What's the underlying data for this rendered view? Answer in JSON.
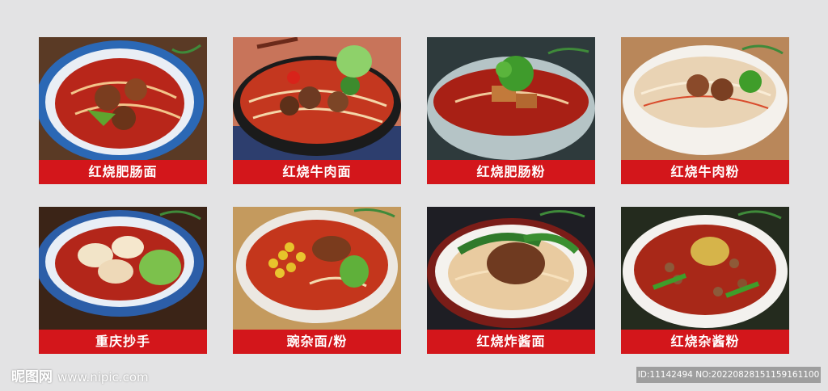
{
  "menu": {
    "items": [
      {
        "name": "红烧肥肠面",
        "photo_icon": "braised-intestine-noodle-photo"
      },
      {
        "name": "红烧牛肉面",
        "photo_icon": "braised-beef-noodle-photo"
      },
      {
        "name": "红烧肥肠粉",
        "photo_icon": "braised-intestine-vermicelli-photo"
      },
      {
        "name": "红烧牛肉粉",
        "photo_icon": "braised-beef-vermicelli-photo"
      },
      {
        "name": "重庆抄手",
        "photo_icon": "chongqing-wonton-photo"
      },
      {
        "name": "豌杂面/粉",
        "photo_icon": "pea-minced-meat-noodle-photo"
      },
      {
        "name": "红烧炸酱面",
        "photo_icon": "braised-zhajiang-noodle-photo"
      },
      {
        "name": "红烧杂酱粉",
        "photo_icon": "braised-zajiang-vermicelli-photo"
      }
    ]
  },
  "watermark": {
    "logo_text": "昵图网",
    "site": "www.nipic.com",
    "id_text": "ID:11142494 NO:20220828151159161100"
  },
  "colors": {
    "label_bg": "#d3161b",
    "background": "#e3e3e4"
  }
}
